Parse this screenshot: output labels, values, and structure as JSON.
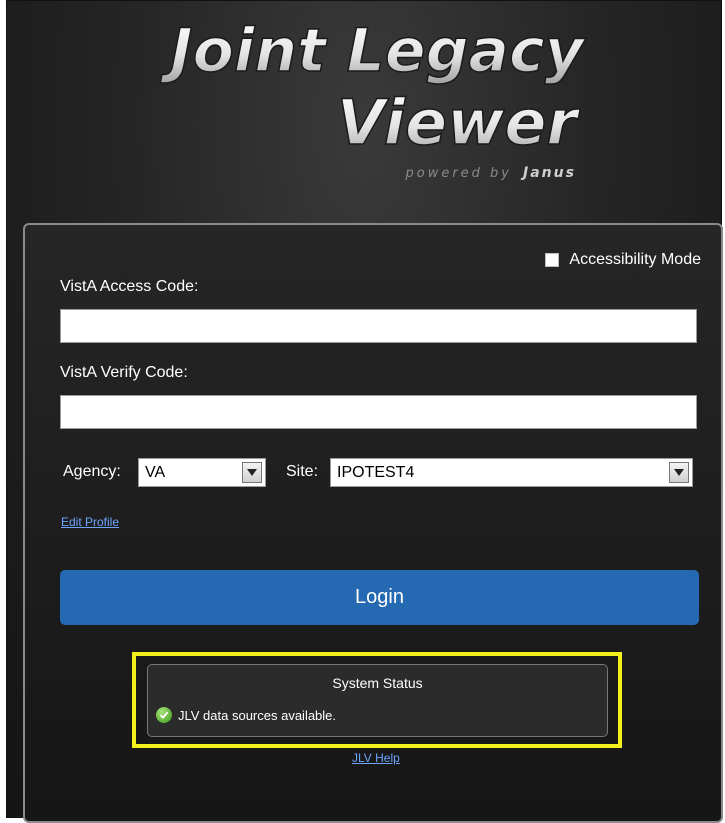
{
  "logo": {
    "line1": "Joint Legacy",
    "line2": "Viewer",
    "tagline_prefix": "powered by",
    "tagline_brand": "Janus"
  },
  "accessibility": {
    "label": "Accessibility Mode"
  },
  "access_code": {
    "label": "VistA Access Code:",
    "value": ""
  },
  "verify_code": {
    "label": "VistA Verify Code:",
    "value": ""
  },
  "agency": {
    "label": "Agency:",
    "selected": "VA"
  },
  "site": {
    "label": "Site:",
    "selected": "IPOTEST4"
  },
  "edit_profile": {
    "label": "Edit Profile"
  },
  "login": {
    "label": "Login"
  },
  "system_status": {
    "title": "System Status",
    "message": "JLV data sources available.",
    "highlight_color": "#f4f01b"
  },
  "help": {
    "label": "JLV Help"
  },
  "colors": {
    "login_button": "#2469b1",
    "link": "#6ea6ff",
    "status_ok": "#3d9a1c"
  },
  "icons": [
    "checkbox-icon",
    "dropdown-arrow-icon",
    "checkmark-icon"
  ]
}
